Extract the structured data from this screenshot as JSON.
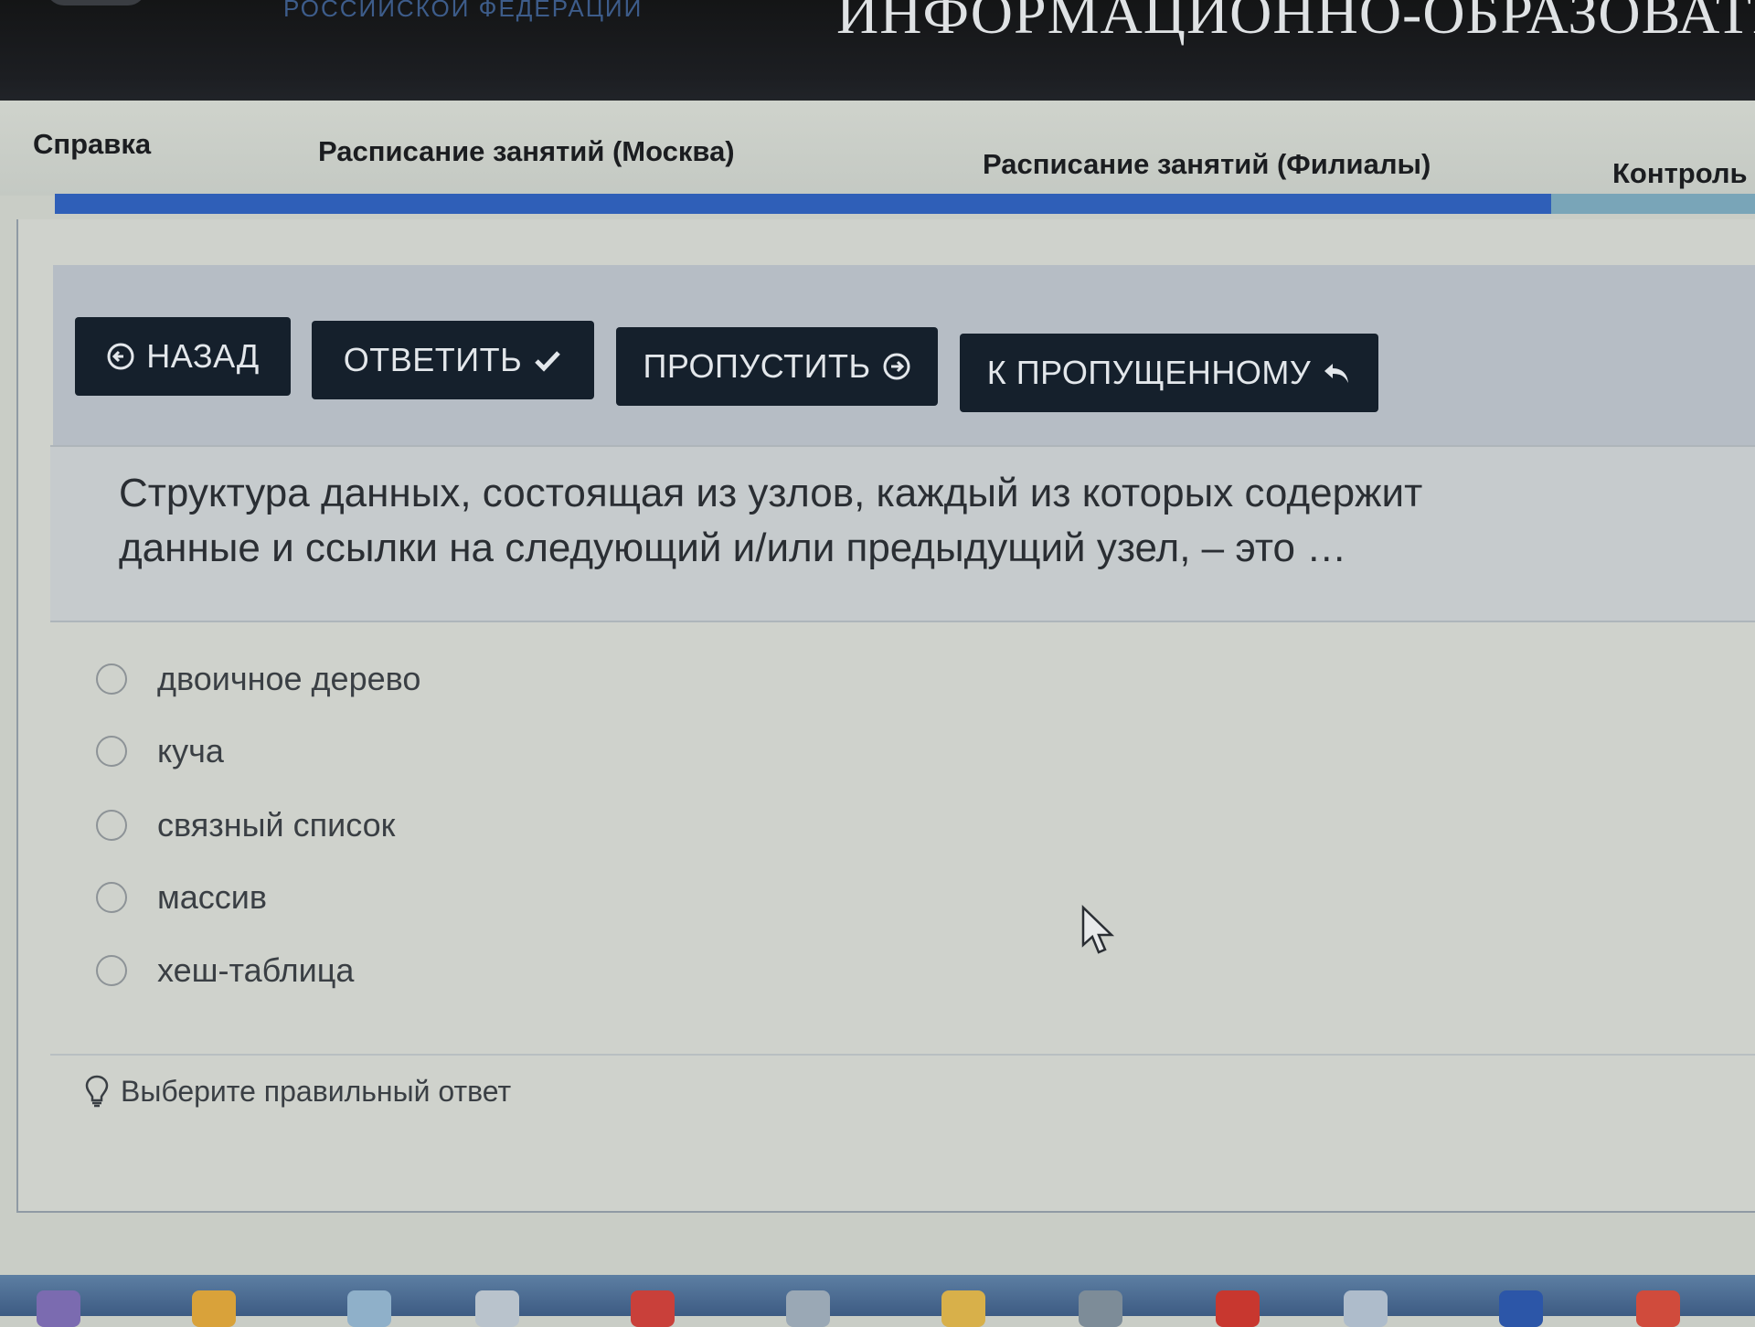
{
  "header": {
    "subtitle": "РОССИЙСКОЙ ФЕДЕРАЦИИ",
    "title": "ИНФОРМАЦИОННО-ОБРАЗОВАТЕЛ"
  },
  "nav": {
    "items": [
      {
        "label": "Справка"
      },
      {
        "label": "Расписание занятий (Москва)"
      },
      {
        "label": "Расписание занятий (Филиалы)"
      },
      {
        "label": "Контроль"
      }
    ]
  },
  "progress": {
    "fraction": 0.88,
    "fill_color": "#2f5fb8"
  },
  "toolbar": {
    "back_label": "НАЗАД",
    "answer_label": "ОТВЕТИТЬ",
    "skip_label": "ПРОПУСТИТЬ",
    "to_skipped_label": "К ПРОПУЩЕННОМУ"
  },
  "question": {
    "line1": "Структура данных, состоящая из узлов, каждый из которых содержит",
    "line2": "данные и ссылки на следующий и/или предыдущий узел, – это …"
  },
  "options": [
    {
      "label": "двоичное дерево"
    },
    {
      "label": "куча"
    },
    {
      "label": "связный список"
    },
    {
      "label": "массив"
    },
    {
      "label": "хеш-таблица"
    }
  ],
  "hint": {
    "text": "Выберите правильный ответ"
  },
  "colors": {
    "button_bg": "#15202c",
    "accent_blue": "#2f5fb8"
  }
}
